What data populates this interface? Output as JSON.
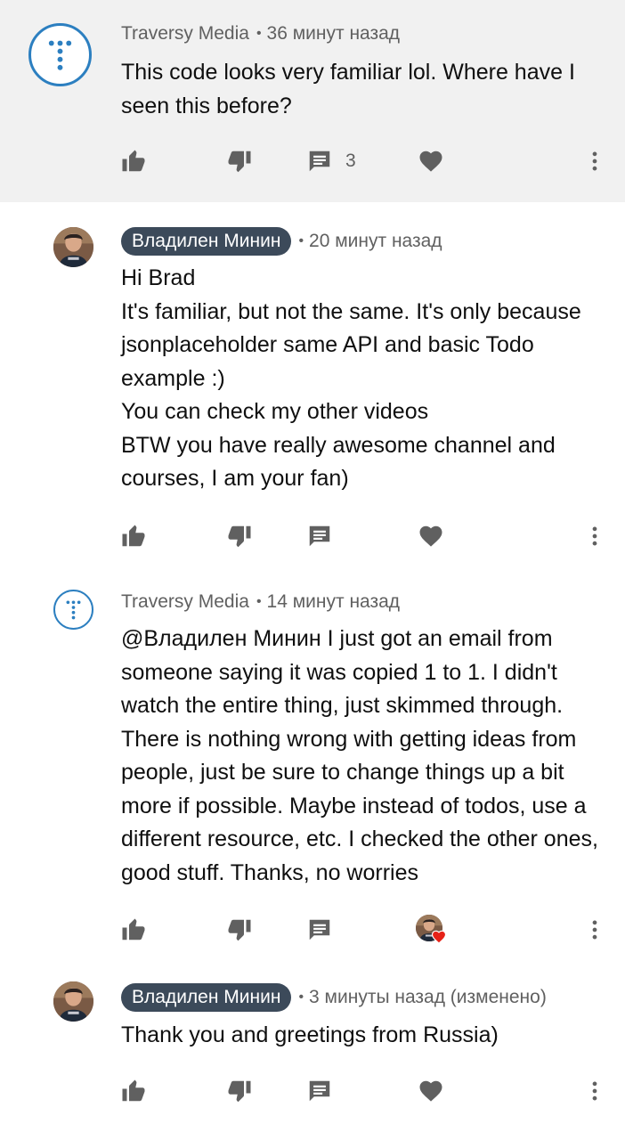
{
  "comments": [
    {
      "author": "Traversy Media",
      "time": "36 минут назад",
      "text": "This code looks very familiar lol. Where have I seen this before?",
      "reply_count": "3",
      "avatar": "traversy-logo-icon"
    },
    {
      "author": "Владилен Минин",
      "time": "20 минут назад",
      "text": "Hi Brad\nIt's familiar, but not the same. It's only because jsonplaceholder same API and basic Todo example :)\nYou can check my other videos\nBTW you have really awesome channel and courses, I am your fan)",
      "avatar": "user-photo"
    },
    {
      "author": "Traversy Media",
      "time": "14 минут назад",
      "text": "@Владилен Минин I just got an email from someone saying it was copied 1 to 1. I didn't watch the entire thing, just skimmed through. There is nothing wrong with getting ideas from people, just be sure to change things up a bit more if possible. Maybe instead of todos, use a different resource, etc. I checked the other ones, good stuff.  Thanks, no worries",
      "avatar": "traversy-logo-icon",
      "creator_heart": true
    },
    {
      "author": "Владилен Минин",
      "time": "3 минуты назад (изменено)",
      "text": "Thank you and greetings from Russia)",
      "avatar": "user-photo"
    }
  ],
  "icons": [
    "like-icon",
    "dislike-icon",
    "reply-icon",
    "heart-icon",
    "more-vert-icon"
  ],
  "colors": {
    "highlight_bg": "#f1f1f1",
    "author_pill": "#3c4a5a",
    "icon_gray": "#606060",
    "traversy_blue": "#2c7fc0",
    "heart_red": "#e62117"
  }
}
